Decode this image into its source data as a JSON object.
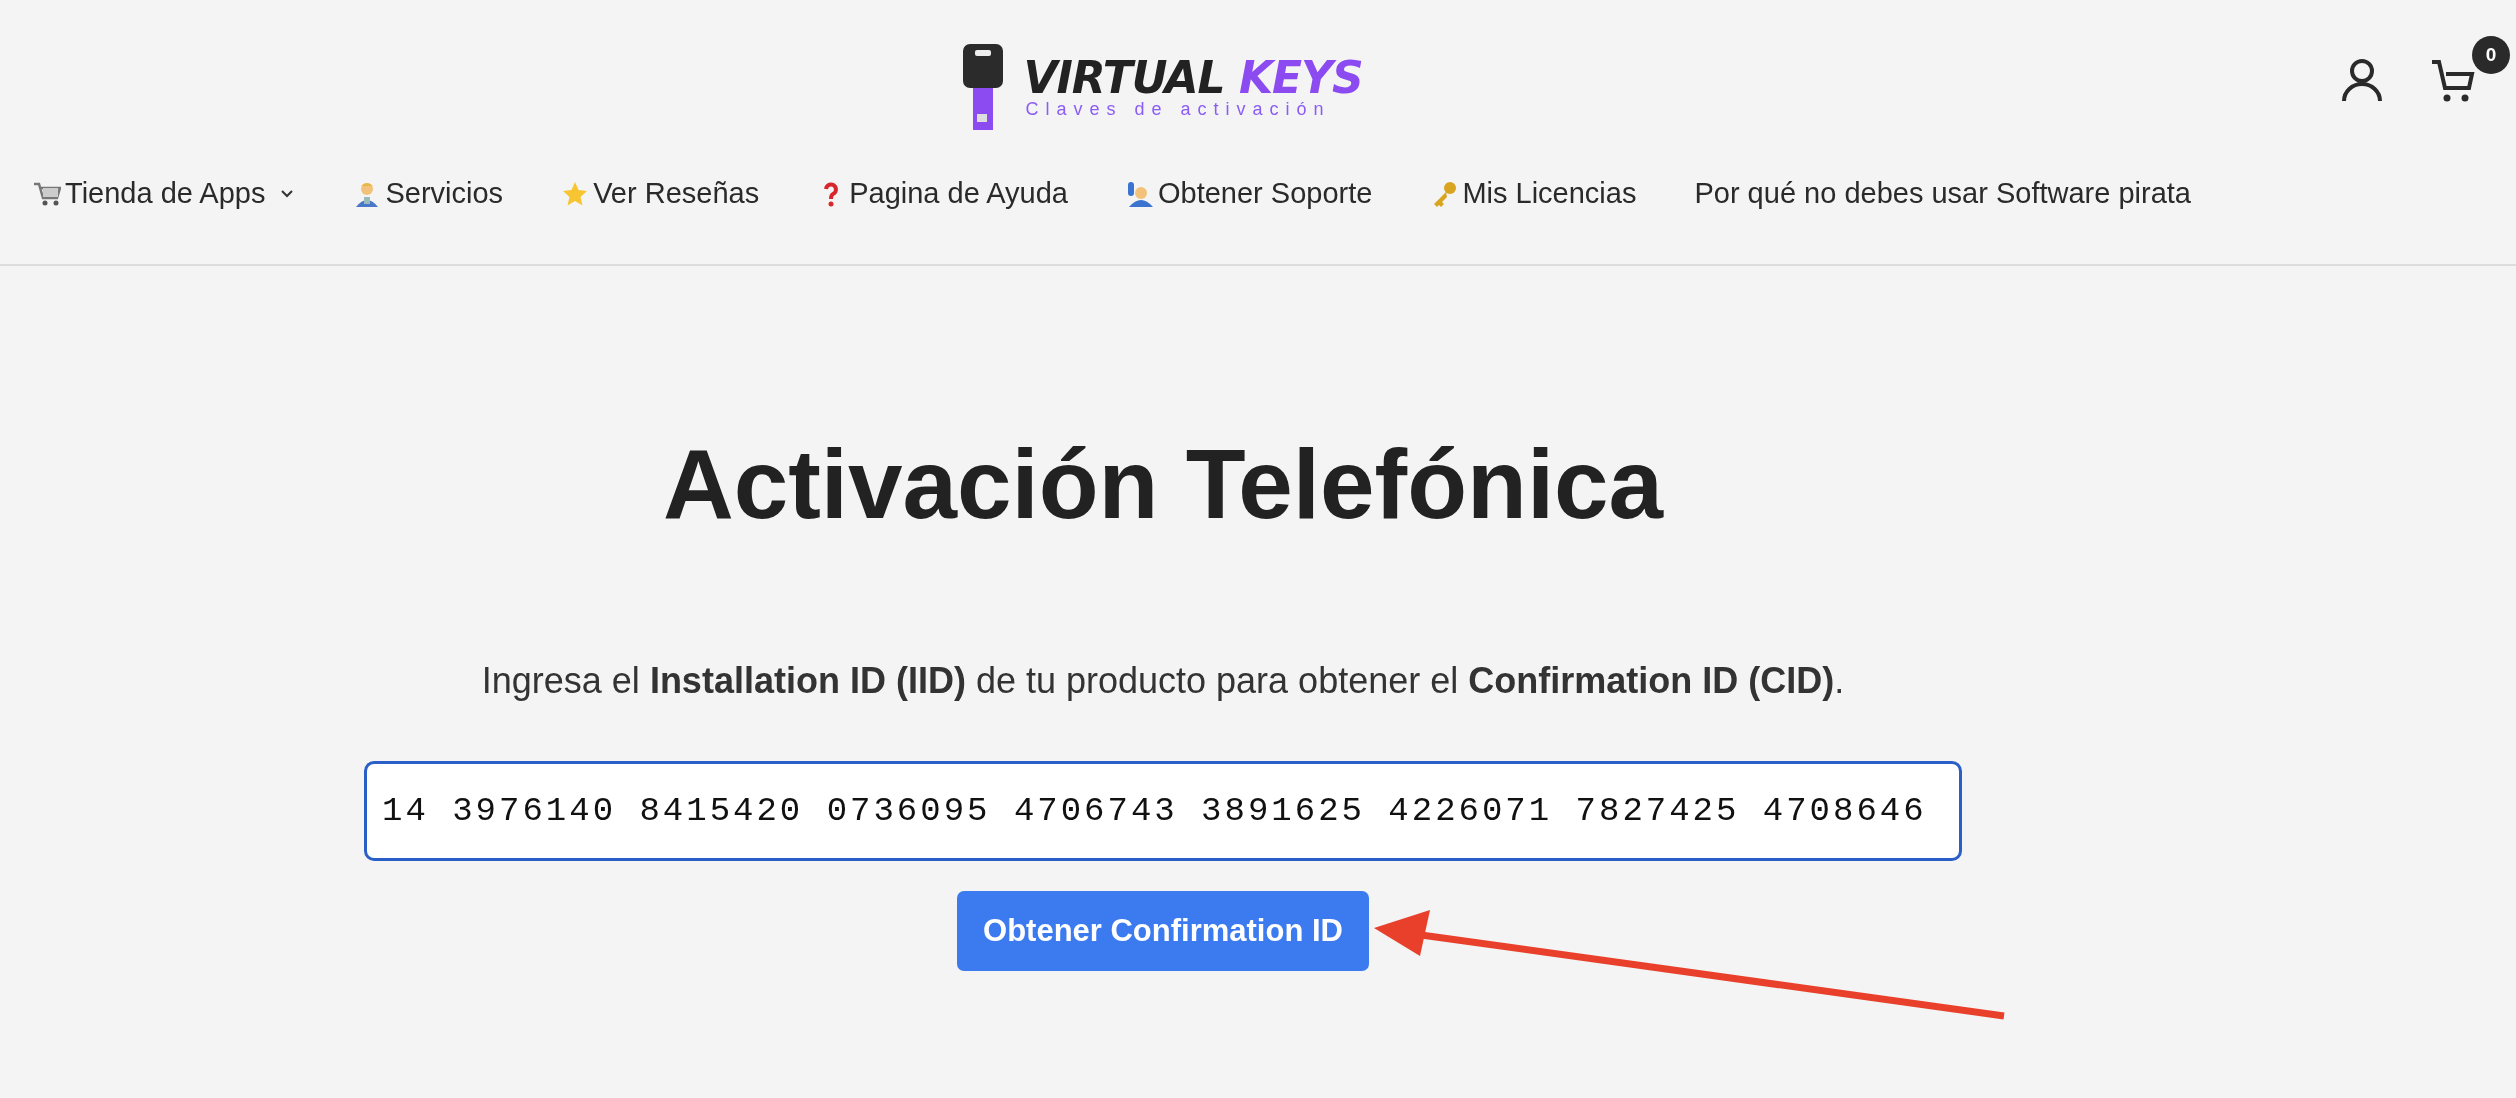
{
  "header": {
    "logo": {
      "title_main": "VIRTUAL",
      "title_accent": "KEYS",
      "tagline": "Claves de activación"
    },
    "cart_count": "0"
  },
  "nav": [
    {
      "label": "Tienda de Apps",
      "dropdown": true
    },
    {
      "label": "Servicios",
      "dropdown": false
    },
    {
      "label": "Ver Reseñas",
      "dropdown": false
    },
    {
      "label": "Pagina de Ayuda",
      "dropdown": false
    },
    {
      "label": "Obtener Soporte",
      "dropdown": false
    },
    {
      "label": "Mis Licencias",
      "dropdown": false
    },
    {
      "label": "Por qué no debes usar Software pirata",
      "dropdown": false
    }
  ],
  "main": {
    "title": "Activación Telefónica",
    "intro": "Ingresa el **Installation ID (IID)** de tu producto para obtener el **Confirmation ID (CID)**.",
    "iid_field": {
      "value": "14 3976140 8415420 0736095 4706743 3891625 4226071 7827425 4708646",
      "focused": true
    },
    "submit": "Obtener Confirmation ID"
  }
}
